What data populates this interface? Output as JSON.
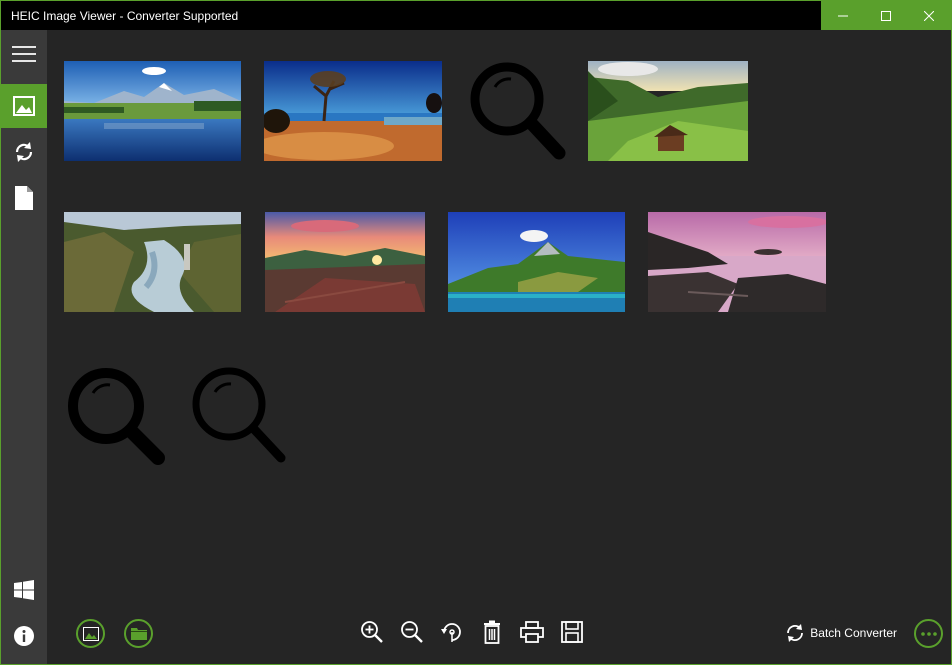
{
  "window": {
    "title": "HEIC Image Viewer - Converter Supported",
    "accent": "#5aa02c",
    "background": "#252525"
  },
  "caption_buttons": [
    {
      "name": "minimize-button",
      "icon": "minimize-icon"
    },
    {
      "name": "maximize-button",
      "icon": "maximize-icon"
    },
    {
      "name": "close-button",
      "icon": "close-icon"
    }
  ],
  "sidebar": {
    "items": [
      {
        "name": "menu",
        "icon": "hamburger-menu-icon",
        "active": false
      },
      {
        "name": "gallery",
        "icon": "image-icon",
        "active": true
      },
      {
        "name": "convert",
        "icon": "sync-icon",
        "active": false
      },
      {
        "name": "document",
        "icon": "document-icon",
        "active": false
      }
    ],
    "bottom_items": [
      {
        "name": "windows",
        "icon": "windows-logo-icon"
      },
      {
        "name": "info",
        "icon": "info-icon"
      }
    ]
  },
  "gallery": {
    "items": [
      {
        "kind": "photo",
        "subject": "mountain-lake"
      },
      {
        "kind": "photo",
        "subject": "tree-beach"
      },
      {
        "kind": "placeholder",
        "icon": "search-icon"
      },
      {
        "kind": "photo",
        "subject": "alpine-valley-cabin"
      },
      {
        "kind": "photo",
        "subject": "canyon-river"
      },
      {
        "kind": "photo",
        "subject": "sunset-hills"
      },
      {
        "kind": "photo",
        "subject": "island-mountain"
      },
      {
        "kind": "photo",
        "subject": "rocky-coast"
      },
      {
        "kind": "placeholder",
        "icon": "search-icon"
      },
      {
        "kind": "placeholder",
        "icon": "search-icon"
      }
    ]
  },
  "toolbar": {
    "left": [
      {
        "name": "open-image-button",
        "icon": "image-icon"
      },
      {
        "name": "open-folder-button",
        "icon": "folder-icon"
      }
    ],
    "center": [
      {
        "name": "zoom-in-button",
        "icon": "zoom-in-icon"
      },
      {
        "name": "zoom-out-icon-button",
        "icon": "zoom-out-icon"
      },
      {
        "name": "rotate-button",
        "icon": "rotate-icon"
      },
      {
        "name": "delete-button",
        "icon": "trash-icon"
      },
      {
        "name": "print-button",
        "icon": "printer-icon"
      },
      {
        "name": "save-button",
        "icon": "save-icon"
      }
    ],
    "batch_label": "Batch Converter",
    "more_icon": "more-icon"
  }
}
